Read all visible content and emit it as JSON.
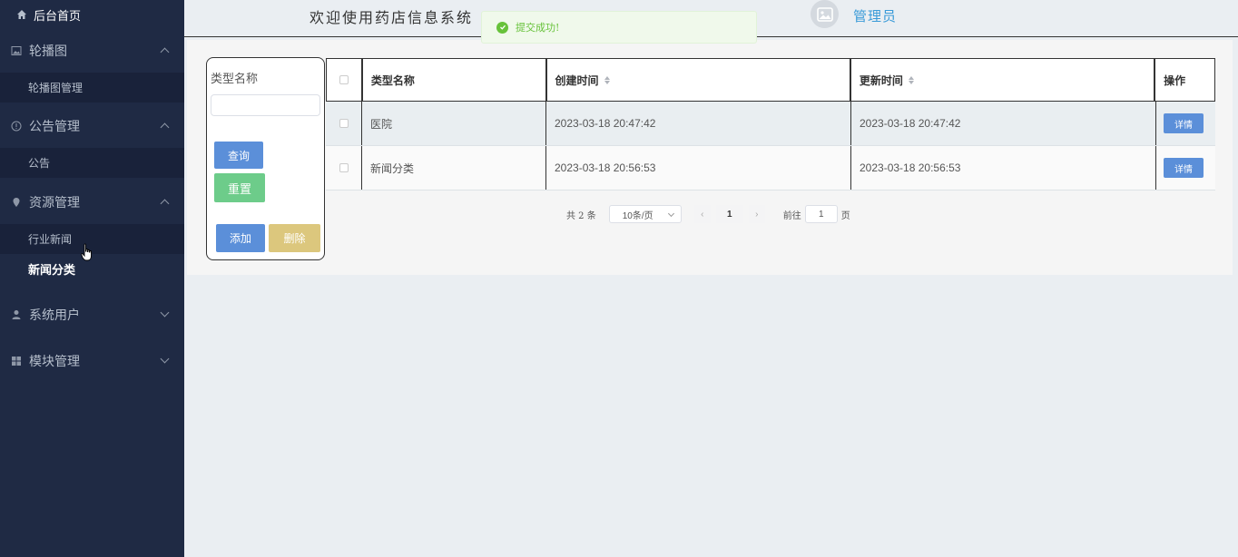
{
  "sidebar": {
    "home": "后台首页",
    "groups": [
      {
        "label": "轮播图",
        "icon": "image-icon",
        "expanded": true,
        "items": [
          {
            "label": "轮播图管理"
          }
        ]
      },
      {
        "label": "公告管理",
        "icon": "info-circle-icon",
        "expanded": true,
        "items": [
          {
            "label": "公告"
          }
        ]
      },
      {
        "label": "资源管理",
        "icon": "location-pin-icon",
        "expanded": true,
        "items": [
          {
            "label": "行业新闻"
          },
          {
            "label": "新闻分类",
            "active": true
          }
        ]
      },
      {
        "label": "系统用户",
        "icon": "user-icon",
        "expanded": false,
        "items": []
      },
      {
        "label": "模块管理",
        "icon": "grid-icon",
        "expanded": false,
        "items": []
      }
    ]
  },
  "header": {
    "welcome": "欢迎使用药店信息系统",
    "user": "管理员"
  },
  "toast": {
    "message": "提交成功!",
    "color": "#67c23a"
  },
  "search": {
    "label": "类型名称",
    "input_value": "",
    "query_label": "查询",
    "reset_label": "重置",
    "add_label": "添加",
    "delete_label": "删除"
  },
  "table": {
    "columns": [
      "类型名称",
      "创建时间",
      "更新时间",
      "操作"
    ],
    "rows": [
      {
        "name": "医院",
        "created": "2023-03-18 20:47:42",
        "updated": "2023-03-18 20:47:42",
        "action": "详情"
      },
      {
        "name": "新闻分类",
        "created": "2023-03-18 20:56:53",
        "updated": "2023-03-18 20:56:53",
        "action": "详情"
      }
    ]
  },
  "pagination": {
    "total": "共 2 条",
    "page_size": "10条/页",
    "current_page": "1",
    "goto_label": "前往",
    "goto_value": "1",
    "page_suffix": "页"
  },
  "colors": {
    "sidebar_bg": "#1f2a44",
    "primary": "#5b8fd9",
    "success": "#6dcc8a",
    "warning": "#dcc77d",
    "admin_text": "#3a9bd8"
  }
}
